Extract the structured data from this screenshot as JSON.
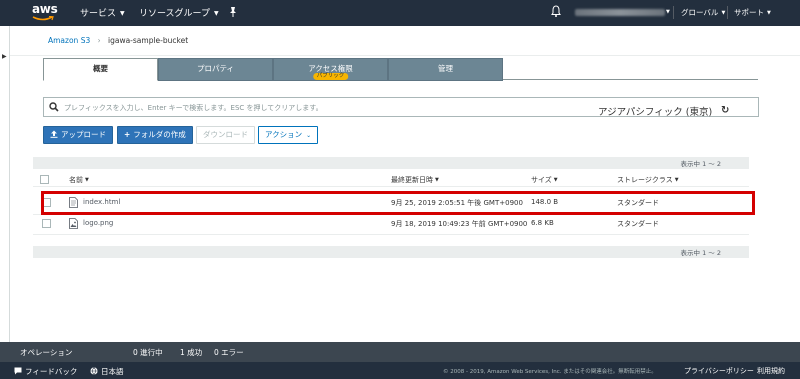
{
  "topnav": {
    "logo_text": "aws",
    "services": "サービス",
    "resource_groups": "リソースグループ",
    "global": "グローバル",
    "support": "サポート"
  },
  "breadcrumb": {
    "root": "Amazon S3",
    "bucket": "igawa-sample-bucket"
  },
  "tabs": [
    {
      "label": "概要",
      "active": true
    },
    {
      "label": "プロパティ",
      "active": false
    },
    {
      "label": "アクセス権限",
      "active": false,
      "badge": "パブリック"
    },
    {
      "label": "管理",
      "active": false
    }
  ],
  "search": {
    "placeholder": "プレフィックスを入力し、Enter キーで検索します。ESC を押してクリアします。"
  },
  "toolbar": {
    "upload": "アップロード",
    "create_folder": "フォルダの作成",
    "download": "ダウンロード",
    "actions": "アクション"
  },
  "region": "アジアパシフィック (東京)",
  "pagination": "表示中 1 ～ 2",
  "table": {
    "columns": [
      "名前",
      "最終更新日時",
      "サイズ",
      "ストレージクラス"
    ],
    "rows": [
      {
        "name": "index.html",
        "modified": "9月 25, 2019 2:05:51 午後 GMT+0900",
        "size": "148.0 B",
        "storage_class": "スタンダード",
        "highlighted": true
      },
      {
        "name": "logo.png",
        "modified": "9月 18, 2019 10:49:23 午前 GMT+0900",
        "size": "6.8 KB",
        "storage_class": "スタンダード",
        "highlighted": false
      }
    ]
  },
  "operations": {
    "label": "オペレーション",
    "in_progress": "0 進行中",
    "success": "1 成功",
    "errors": "0 エラー"
  },
  "footer": {
    "feedback": "フィードバック",
    "language": "日本語",
    "copyright": "© 2008 - 2019, Amazon Web Services, Inc. またはその関連会社。無断転用禁止。",
    "privacy": "プライバシーポリシー",
    "terms": "利用規約"
  },
  "colors": {
    "nav_bg": "#232f3e",
    "tab_bg": "#6c8694",
    "primary": "#2e73b8",
    "link": "#0073bb",
    "badge": "#f7b500",
    "highlight": "#d40000"
  }
}
